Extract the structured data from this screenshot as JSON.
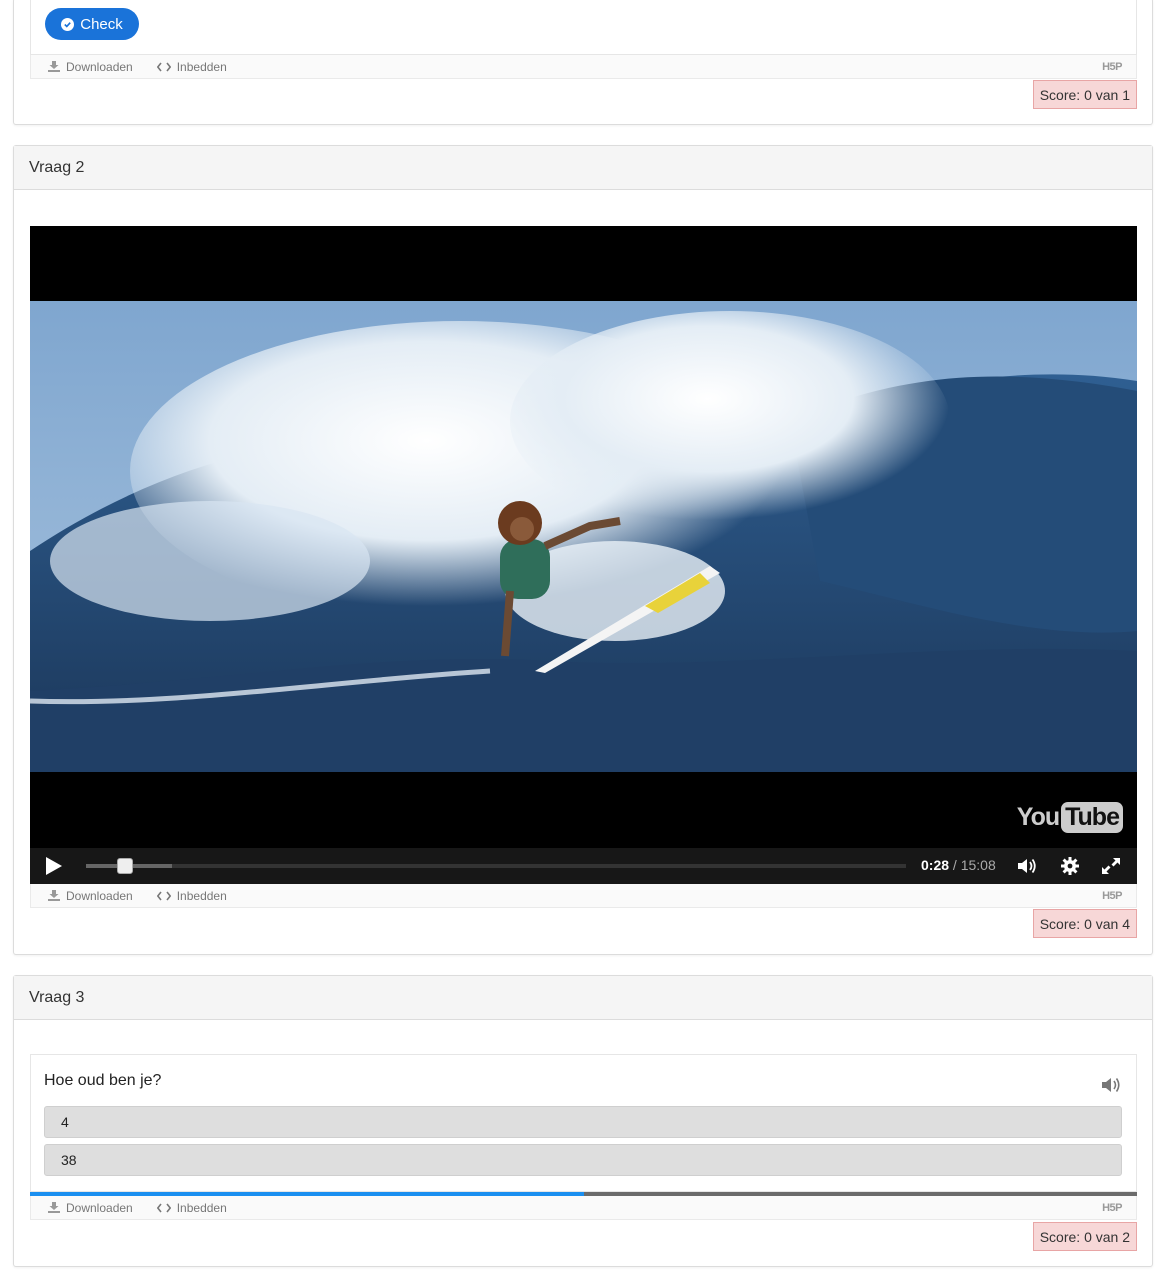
{
  "common": {
    "download_label": "Downloaden",
    "embed_label": "Inbedden",
    "h5p_logo": "H5P"
  },
  "question1": {
    "check_label": "Check",
    "score": "Score: 0 van 1"
  },
  "question2": {
    "title": "Vraag 2",
    "video": {
      "brand_you": "You",
      "brand_tube": "Tube",
      "current_time": "0:28",
      "separator": " / ",
      "duration": "15:08",
      "played_fraction": 0.031,
      "buffered_fraction": 0.105
    },
    "score": "Score: 0 van 4"
  },
  "question3": {
    "title": "Vraag 3",
    "question": "Hoe oud ben je?",
    "answers": [
      "4",
      "38"
    ],
    "progress_fraction": 0.5,
    "score": "Score: 0 van 2"
  },
  "colors": {
    "accent": "#1a73d9",
    "score_bg": "#f7d7d7",
    "progress": "#1a8ff0"
  }
}
